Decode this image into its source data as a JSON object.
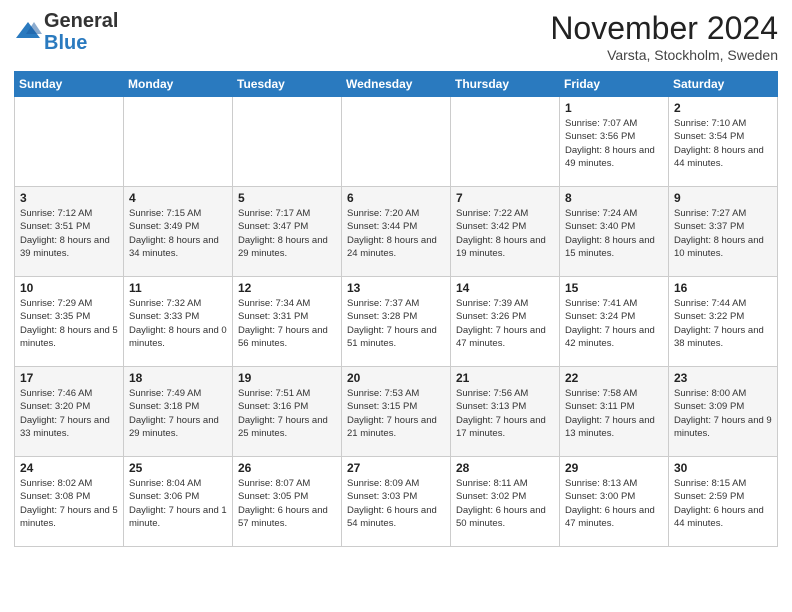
{
  "logo": {
    "general": "General",
    "blue": "Blue"
  },
  "header": {
    "month": "November 2024",
    "location": "Varsta, Stockholm, Sweden"
  },
  "days_of_week": [
    "Sunday",
    "Monday",
    "Tuesday",
    "Wednesday",
    "Thursday",
    "Friday",
    "Saturday"
  ],
  "weeks": [
    [
      {
        "day": "",
        "info": ""
      },
      {
        "day": "",
        "info": ""
      },
      {
        "day": "",
        "info": ""
      },
      {
        "day": "",
        "info": ""
      },
      {
        "day": "",
        "info": ""
      },
      {
        "day": "1",
        "info": "Sunrise: 7:07 AM\nSunset: 3:56 PM\nDaylight: 8 hours\nand 49 minutes."
      },
      {
        "day": "2",
        "info": "Sunrise: 7:10 AM\nSunset: 3:54 PM\nDaylight: 8 hours\nand 44 minutes."
      }
    ],
    [
      {
        "day": "3",
        "info": "Sunrise: 7:12 AM\nSunset: 3:51 PM\nDaylight: 8 hours\nand 39 minutes."
      },
      {
        "day": "4",
        "info": "Sunrise: 7:15 AM\nSunset: 3:49 PM\nDaylight: 8 hours\nand 34 minutes."
      },
      {
        "day": "5",
        "info": "Sunrise: 7:17 AM\nSunset: 3:47 PM\nDaylight: 8 hours\nand 29 minutes."
      },
      {
        "day": "6",
        "info": "Sunrise: 7:20 AM\nSunset: 3:44 PM\nDaylight: 8 hours\nand 24 minutes."
      },
      {
        "day": "7",
        "info": "Sunrise: 7:22 AM\nSunset: 3:42 PM\nDaylight: 8 hours\nand 19 minutes."
      },
      {
        "day": "8",
        "info": "Sunrise: 7:24 AM\nSunset: 3:40 PM\nDaylight: 8 hours\nand 15 minutes."
      },
      {
        "day": "9",
        "info": "Sunrise: 7:27 AM\nSunset: 3:37 PM\nDaylight: 8 hours\nand 10 minutes."
      }
    ],
    [
      {
        "day": "10",
        "info": "Sunrise: 7:29 AM\nSunset: 3:35 PM\nDaylight: 8 hours\nand 5 minutes."
      },
      {
        "day": "11",
        "info": "Sunrise: 7:32 AM\nSunset: 3:33 PM\nDaylight: 8 hours\nand 0 minutes."
      },
      {
        "day": "12",
        "info": "Sunrise: 7:34 AM\nSunset: 3:31 PM\nDaylight: 7 hours\nand 56 minutes."
      },
      {
        "day": "13",
        "info": "Sunrise: 7:37 AM\nSunset: 3:28 PM\nDaylight: 7 hours\nand 51 minutes."
      },
      {
        "day": "14",
        "info": "Sunrise: 7:39 AM\nSunset: 3:26 PM\nDaylight: 7 hours\nand 47 minutes."
      },
      {
        "day": "15",
        "info": "Sunrise: 7:41 AM\nSunset: 3:24 PM\nDaylight: 7 hours\nand 42 minutes."
      },
      {
        "day": "16",
        "info": "Sunrise: 7:44 AM\nSunset: 3:22 PM\nDaylight: 7 hours\nand 38 minutes."
      }
    ],
    [
      {
        "day": "17",
        "info": "Sunrise: 7:46 AM\nSunset: 3:20 PM\nDaylight: 7 hours\nand 33 minutes."
      },
      {
        "day": "18",
        "info": "Sunrise: 7:49 AM\nSunset: 3:18 PM\nDaylight: 7 hours\nand 29 minutes."
      },
      {
        "day": "19",
        "info": "Sunrise: 7:51 AM\nSunset: 3:16 PM\nDaylight: 7 hours\nand 25 minutes."
      },
      {
        "day": "20",
        "info": "Sunrise: 7:53 AM\nSunset: 3:15 PM\nDaylight: 7 hours\nand 21 minutes."
      },
      {
        "day": "21",
        "info": "Sunrise: 7:56 AM\nSunset: 3:13 PM\nDaylight: 7 hours\nand 17 minutes."
      },
      {
        "day": "22",
        "info": "Sunrise: 7:58 AM\nSunset: 3:11 PM\nDaylight: 7 hours\nand 13 minutes."
      },
      {
        "day": "23",
        "info": "Sunrise: 8:00 AM\nSunset: 3:09 PM\nDaylight: 7 hours\nand 9 minutes."
      }
    ],
    [
      {
        "day": "24",
        "info": "Sunrise: 8:02 AM\nSunset: 3:08 PM\nDaylight: 7 hours\nand 5 minutes."
      },
      {
        "day": "25",
        "info": "Sunrise: 8:04 AM\nSunset: 3:06 PM\nDaylight: 7 hours\nand 1 minute."
      },
      {
        "day": "26",
        "info": "Sunrise: 8:07 AM\nSunset: 3:05 PM\nDaylight: 6 hours\nand 57 minutes."
      },
      {
        "day": "27",
        "info": "Sunrise: 8:09 AM\nSunset: 3:03 PM\nDaylight: 6 hours\nand 54 minutes."
      },
      {
        "day": "28",
        "info": "Sunrise: 8:11 AM\nSunset: 3:02 PM\nDaylight: 6 hours\nand 50 minutes."
      },
      {
        "day": "29",
        "info": "Sunrise: 8:13 AM\nSunset: 3:00 PM\nDaylight: 6 hours\nand 47 minutes."
      },
      {
        "day": "30",
        "info": "Sunrise: 8:15 AM\nSunset: 2:59 PM\nDaylight: 6 hours\nand 44 minutes."
      }
    ]
  ]
}
